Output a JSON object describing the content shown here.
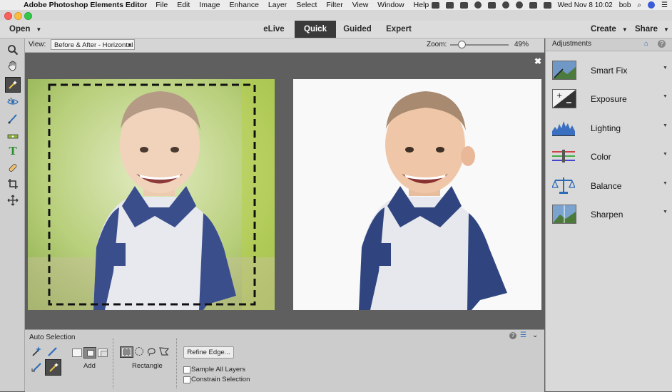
{
  "menubar": {
    "app_name": "Adobe Photoshop Elements Editor",
    "items": [
      "File",
      "Edit",
      "Image",
      "Enhance",
      "Layer",
      "Select",
      "Filter",
      "View",
      "Window",
      "Help"
    ],
    "clock": "Wed Nov 8  10:02",
    "user": "bob"
  },
  "topbar": {
    "open_label": "Open",
    "modes": [
      "eLive",
      "Quick",
      "Guided",
      "Expert"
    ],
    "active_mode": "Quick",
    "create_label": "Create",
    "share_label": "Share"
  },
  "viewbar": {
    "view_label": "View:",
    "view_value": "Before & After - Horizontal",
    "zoom_label": "Zoom:",
    "zoom_value": "49%",
    "zoom_fraction": 0.49
  },
  "tools": [
    {
      "name": "zoom-tool-icon",
      "glyph": "🔍"
    },
    {
      "name": "hand-tool-icon",
      "glyph": "✋"
    },
    {
      "name": "quick-selection-tool-icon",
      "glyph": "✦",
      "selected": true
    },
    {
      "name": "red-eye-tool-icon",
      "glyph": "◉"
    },
    {
      "name": "whiten-teeth-tool-icon",
      "glyph": "✎"
    },
    {
      "name": "straighten-tool-icon",
      "glyph": "▭"
    },
    {
      "name": "type-tool-icon",
      "glyph": "T"
    },
    {
      "name": "spot-healing-tool-icon",
      "glyph": "✚"
    },
    {
      "name": "crop-tool-icon",
      "glyph": "⌗"
    },
    {
      "name": "move-tool-icon",
      "glyph": "✥"
    }
  ],
  "adjustments": {
    "title": "Adjustments",
    "items": [
      {
        "label": "Smart Fix",
        "icon": "smart-fix-icon"
      },
      {
        "label": "Exposure",
        "icon": "exposure-icon"
      },
      {
        "label": "Lighting",
        "icon": "lighting-icon"
      },
      {
        "label": "Color",
        "icon": "color-icon"
      },
      {
        "label": "Balance",
        "icon": "balance-icon"
      },
      {
        "label": "Sharpen",
        "icon": "sharpen-icon"
      }
    ]
  },
  "options": {
    "title": "Auto Selection",
    "add_label": "Add",
    "shape_label": "Rectangle",
    "refine_edge_label": "Refine Edge...",
    "sample_all_layers_label": "Sample All Layers",
    "constrain_selection_label": "Constrain Selection"
  },
  "colors": {
    "active_mode_bg": "#3a3a3a",
    "canvas_bg": "#5f5f5f",
    "panel_bg": "#d9d9d9"
  }
}
